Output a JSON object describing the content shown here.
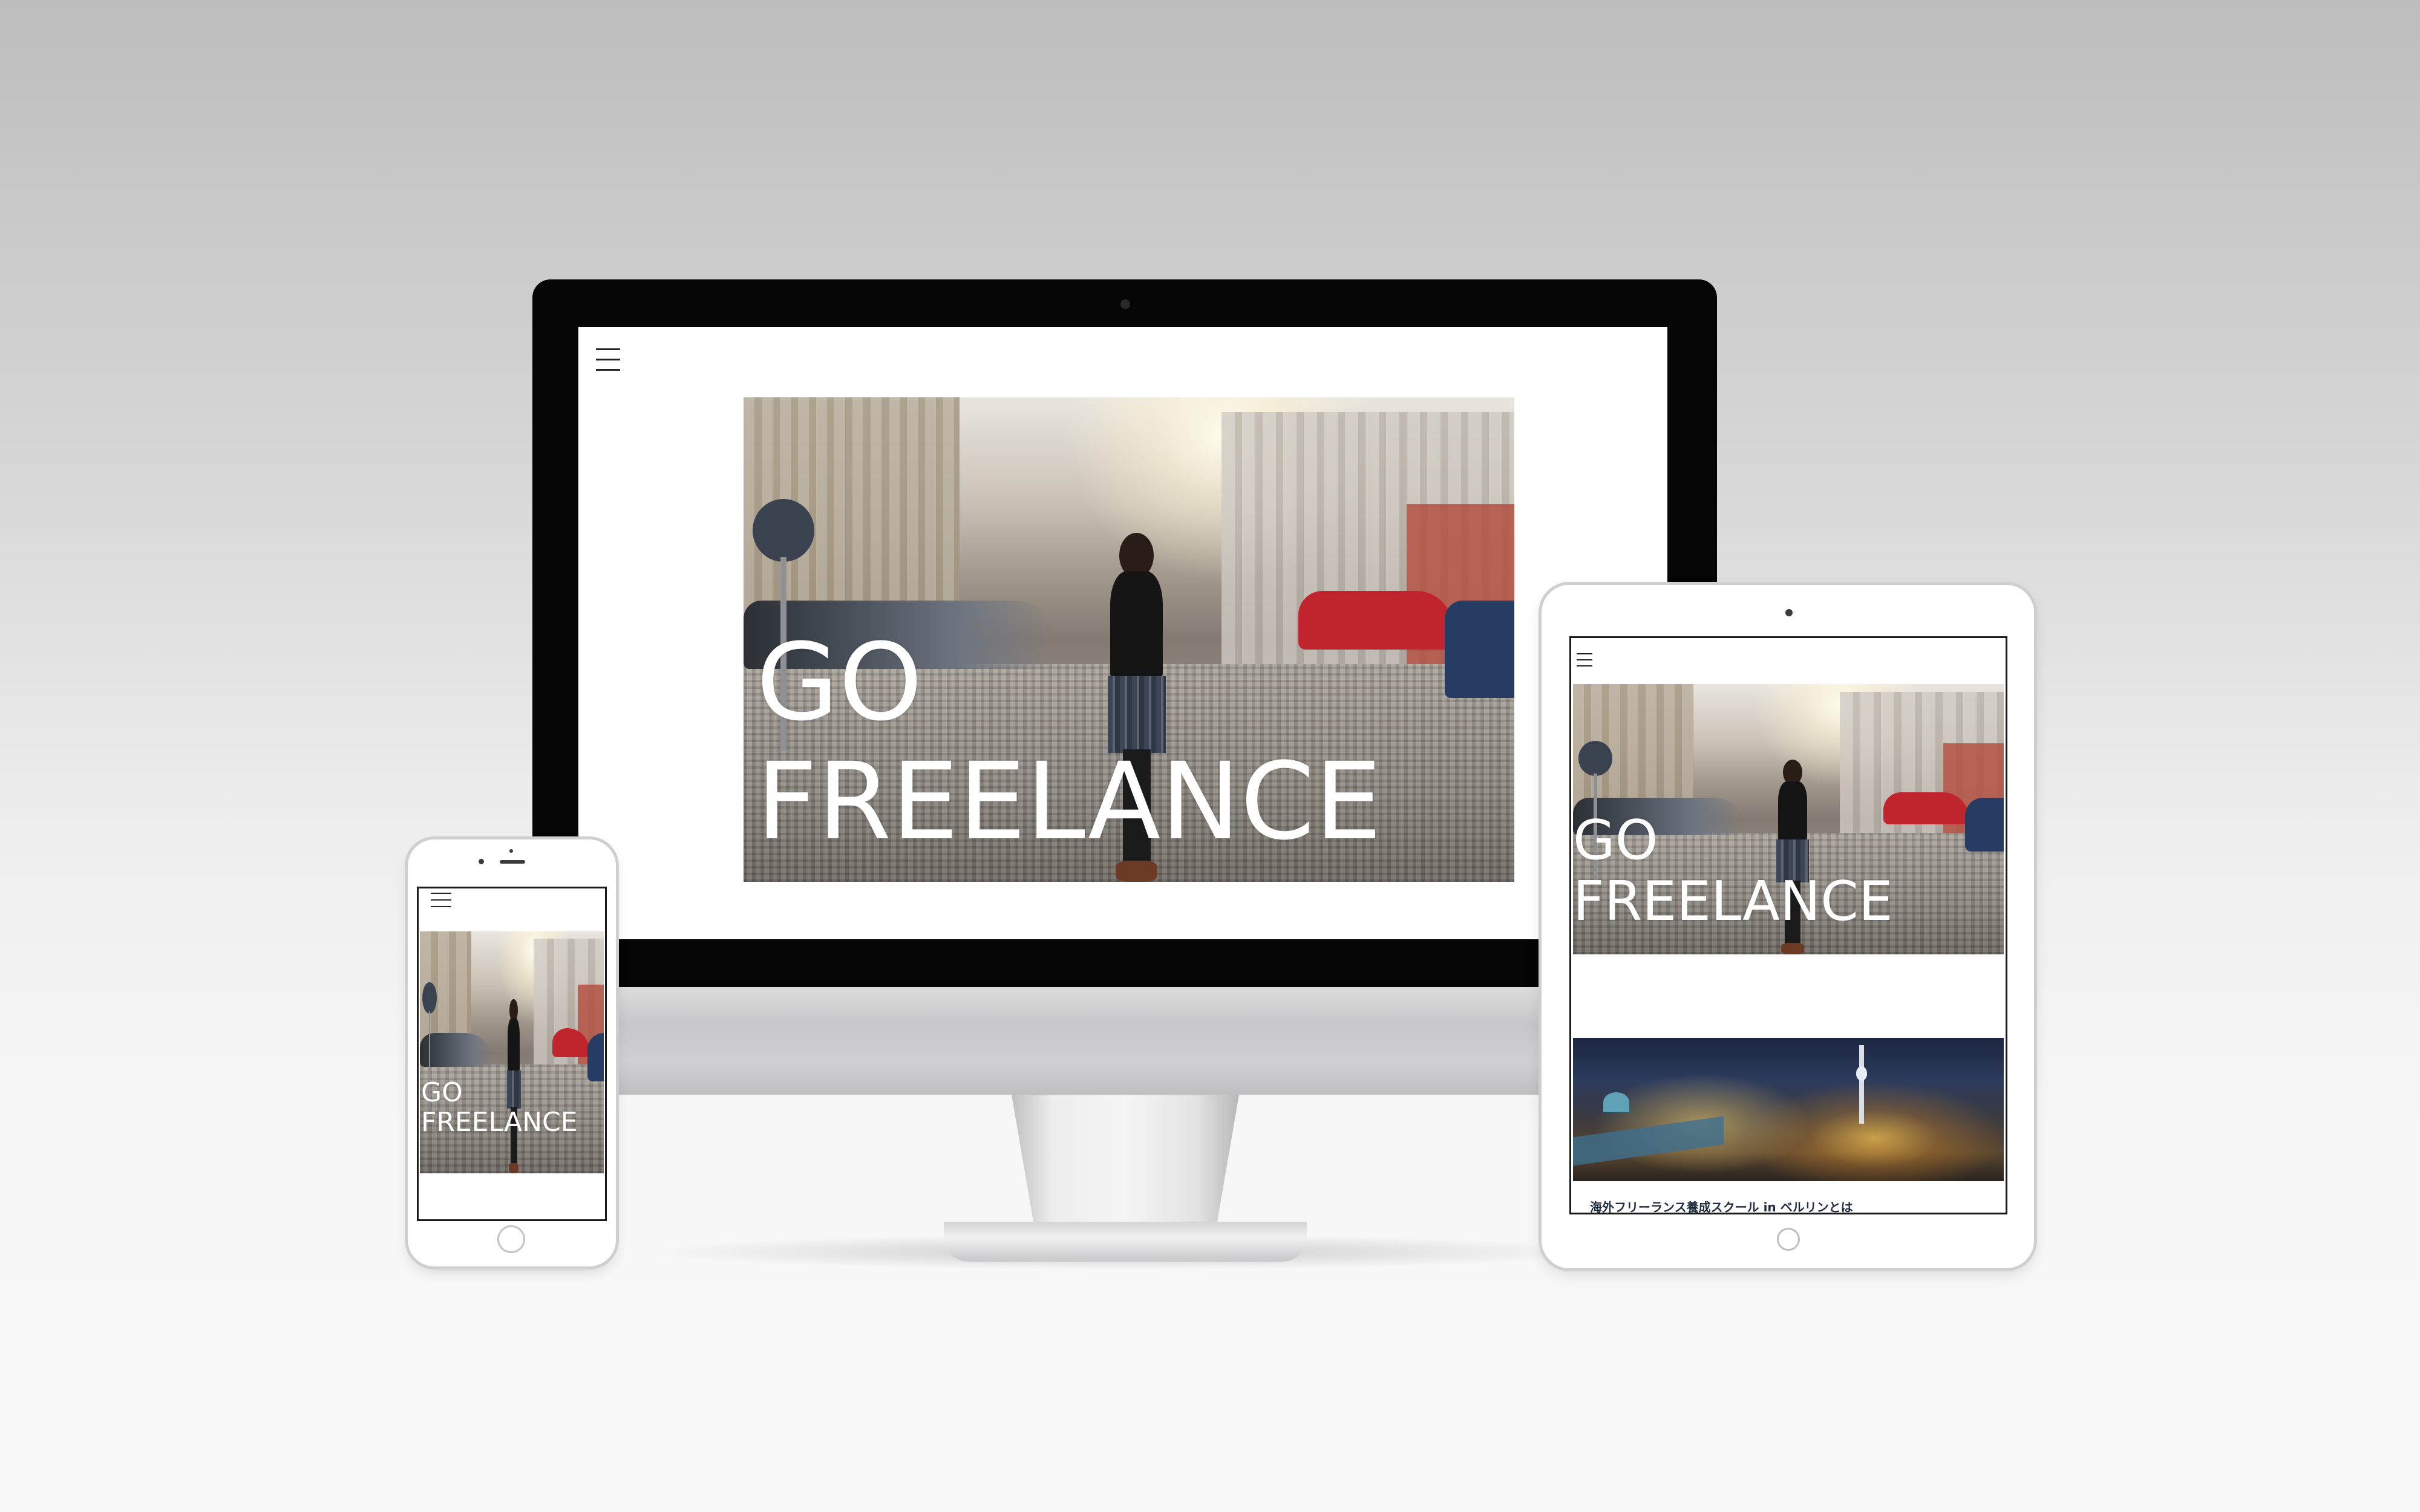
{
  "desktop": {
    "hero_text": "GO\nFREELANCE",
    "photo_alt": "street photo"
  },
  "tablet": {
    "hero_text": "GO\nFREELANCE",
    "article_title": "海外フリーランス養成スクール in ベルリンとは"
  },
  "phone": {
    "hero_text": "GO\nFREELANCE"
  },
  "icons": {
    "menu": "hamburger-menu-icon",
    "camera": "camera-icon",
    "home_button": "home-button-icon"
  },
  "colors": {
    "hero_text": "#ffffff",
    "device_bezel": "#050505",
    "page_background": "#ffffff",
    "brick": "#b24a3b",
    "red_car": "#c0242d"
  }
}
